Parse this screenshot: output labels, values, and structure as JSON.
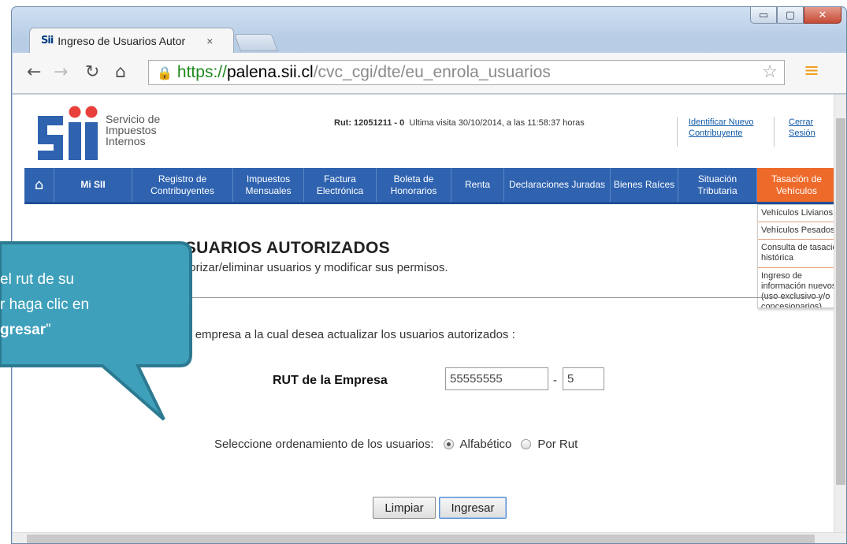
{
  "browser": {
    "tab_title": "Ingreso de Usuarios Autor",
    "tab_favicon": "Sii",
    "tab_close": "×",
    "url_scheme": "https://",
    "url_host": "palena.sii.cl",
    "url_path": "/cvc_cgi/dte/eu_enrola_usuarios",
    "window_buttons": {
      "minimize": "▭",
      "maximize": "▢",
      "close": "✕"
    }
  },
  "header": {
    "logo_word": "Sii",
    "logo_lines": [
      "Servicio de",
      "Impuestos",
      "Internos"
    ],
    "rut_label": "Rut: 12051211 - 0",
    "last_visit": "Ultima visita 30/10/2014, a las 11:58:37 horas",
    "identify_link": [
      "Identificar Nuevo",
      "Contribuyente"
    ],
    "logout_link": [
      "Cerrar",
      "Sesión"
    ]
  },
  "nav": {
    "items": [
      {
        "label": "Mi SII"
      },
      {
        "label": "Registro de Contribuyentes"
      },
      {
        "label": "Impuestos Mensuales"
      },
      {
        "label": "Factura Electrónica"
      },
      {
        "label": "Boleta de Honorarios"
      },
      {
        "label": "Renta"
      },
      {
        "label": "Declaraciones Juradas"
      },
      {
        "label": "Bienes Raíces"
      },
      {
        "label": "Situación Tributaria"
      },
      {
        "label": "Tasación de Vehículos"
      }
    ],
    "dropdown": [
      "Vehículos Livianos",
      "Vehículos Pesados",
      "Consulta de tasación histórica",
      "Ingreso de información nuevos (uso exclusivo y/o concesionarios)"
    ]
  },
  "page": {
    "title": "MANTENCION DE USUARIOS AUTORIZADOS",
    "subtitle": "usted podrá autorizar/eliminar usuarios y modificar sus permisos.",
    "instruction": "de la empresa a la cual desea actualizar los usuarios autorizados :",
    "rut_label": "RUT de la Empresa",
    "rut_value": "55555555",
    "dash": "-",
    "dv_value": "5",
    "order_label": "Seleccione ordenamiento de los usuarios:",
    "order_options": [
      "Alfabético",
      "Por Rut"
    ],
    "order_selected": "Alfabético",
    "clear_button": "Limpiar",
    "submit_button": "Ingresar"
  },
  "callout": {
    "line1": "el rut de su",
    "line2": "r haga clic en",
    "line3_bold": "gresar",
    "line3_end": "”"
  },
  "colors": {
    "nav_blue": "#2f63b0",
    "nav_active": "#ee6a2b",
    "callout_fill": "#3fa0bb",
    "callout_border": "#2c7a91"
  }
}
